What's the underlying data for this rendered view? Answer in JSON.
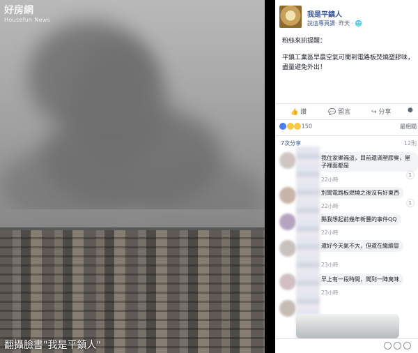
{
  "photo": {
    "watermark_title": "好房網",
    "watermark_sub": "Housefun News",
    "caption": "翻攝臉書\"我是平鎮人\""
  },
  "post": {
    "page_name": "我是平鎮人",
    "sub_strong": "說這專頁讚",
    "sub_time": "· 昨天 · ",
    "more": "···",
    "greeting": "粉絲來訊提醒：",
    "body": "平鎮工業區早晨空氣可聞到電路板焚燒塑膠味，盡量避免外出！",
    "reactions_count": "150",
    "reactions_right": "最相關",
    "shares": "7次分享",
    "comments_count": "12則",
    "actions": {
      "like": "讚",
      "comment": "留言",
      "share": "分享"
    }
  },
  "comments": [
    {
      "text": "我住家樂福這，目前還滿塑膠臭，屋子裡面都是",
      "time": "22小時",
      "badge": "1"
    },
    {
      "text": "別聞電路板燃燒之後沒有好東西",
      "time": "22小時",
      "badge": "1"
    },
    {
      "text": "縣我想起前幾年新豐的事件QQ",
      "time": "22小時",
      "badge": ""
    },
    {
      "text": "還好今天氣不大，但還在繼續冒",
      "time": "23小時",
      "badge": ""
    },
    {
      "text": "早上有一段時間，聞到一陣臭味",
      "time": "23小時",
      "badge": ""
    }
  ],
  "colors": {
    "link": "#385898",
    "meta": "#90949c"
  }
}
